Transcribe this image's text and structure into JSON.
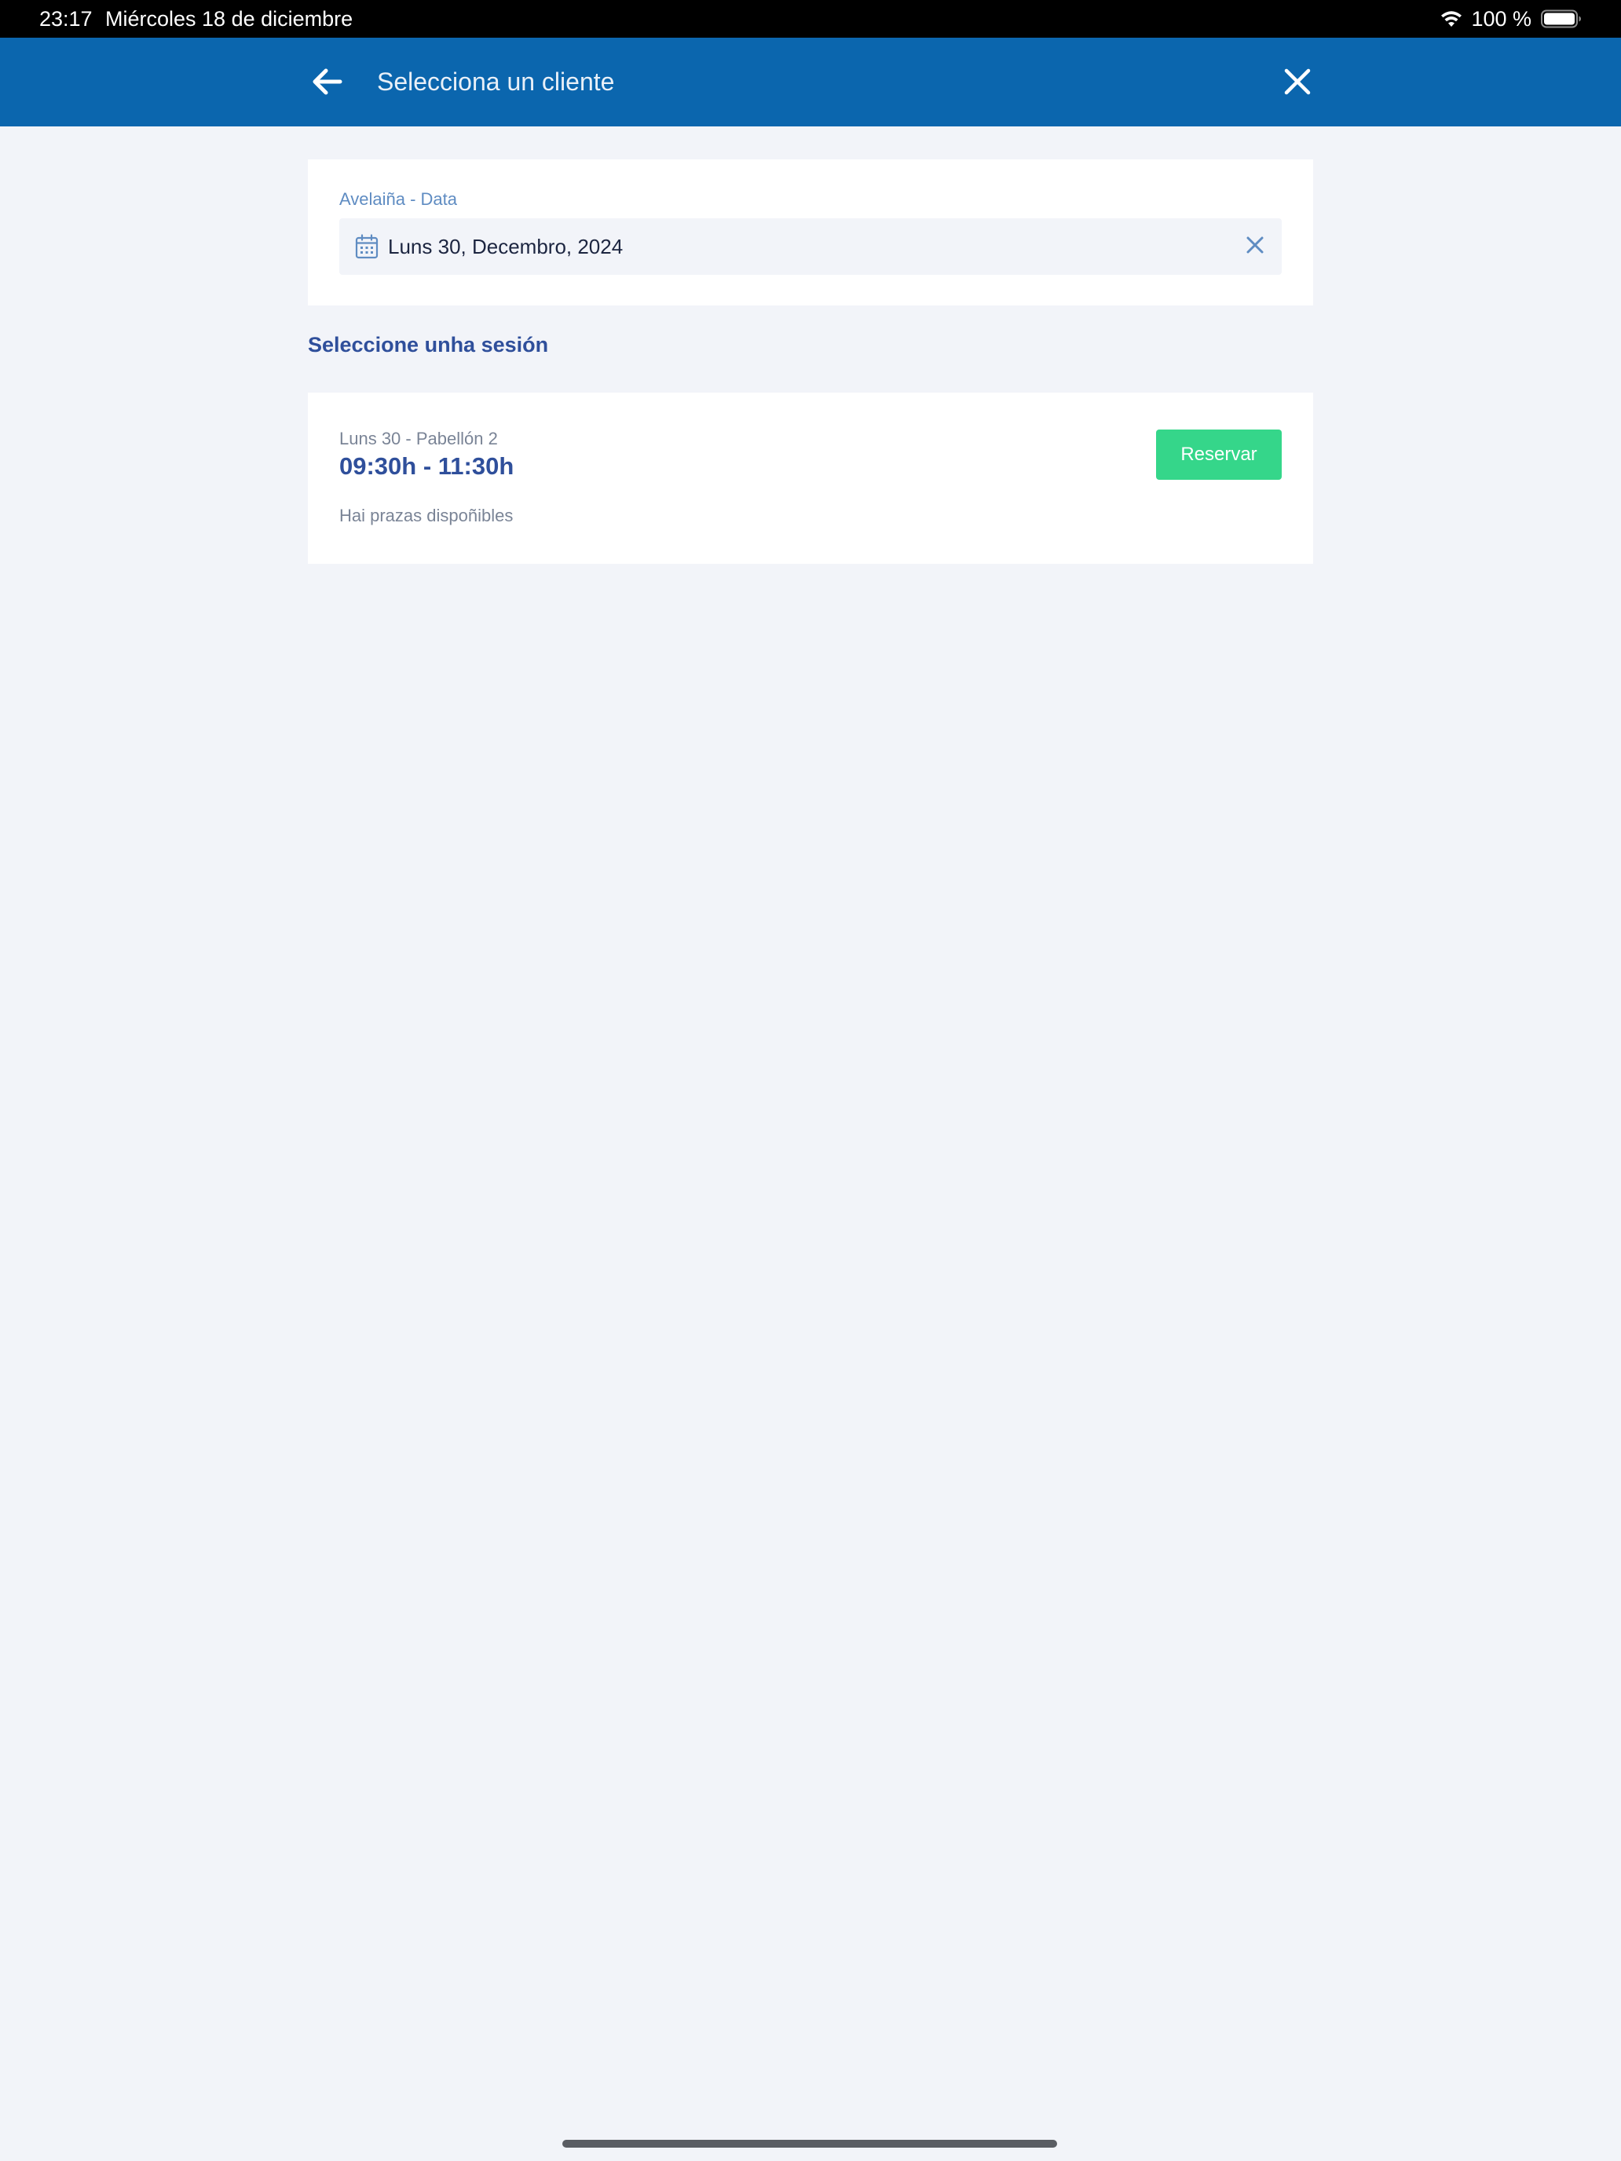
{
  "status_bar": {
    "time": "23:17",
    "date": "Miércoles 18 de diciembre",
    "battery_percent_text": "100 %",
    "battery_level": 1.0,
    "icons": [
      "wifi-icon",
      "battery-icon"
    ]
  },
  "header": {
    "title": "Selecciona un cliente",
    "back_icon": "arrow-left-icon",
    "close_icon": "close-icon",
    "background_color": "#0b66ae"
  },
  "date_filter": {
    "label": "Avelaiña - Data",
    "value": "Luns 30, Decembro, 2024",
    "icon": "calendar-icon",
    "clear_icon": "close-icon"
  },
  "sessions_section": {
    "heading": "Seleccione unha sesión",
    "sessions": [
      {
        "subtitle": "Luns 30 - Pabellón 2",
        "time_range": "09:30h - 11:30h",
        "availability": "Hai prazas dispoñibles",
        "button_label": "Reservar",
        "button_color": "#35d68a"
      }
    ]
  }
}
